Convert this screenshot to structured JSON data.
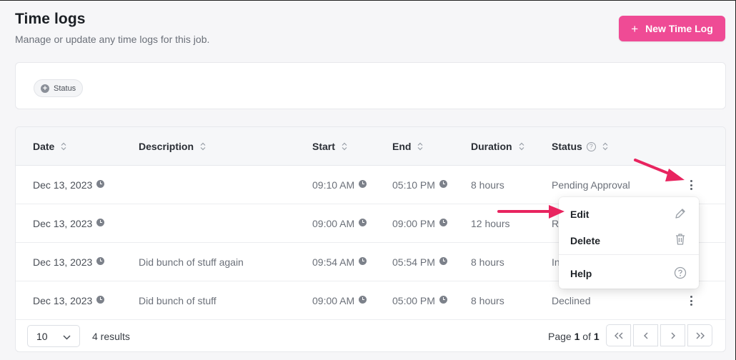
{
  "header": {
    "title": "Time logs",
    "subtitle": "Manage or update any time logs for this job.",
    "new_button_label": "New Time Log"
  },
  "filters": {
    "status_chip_label": "Status"
  },
  "table": {
    "columns": [
      "Date",
      "Description",
      "Start",
      "End",
      "Duration",
      "Status"
    ],
    "rows": [
      {
        "date": "Dec 13, 2023",
        "description": "",
        "start": "09:10 AM",
        "end": "05:10 PM",
        "duration": "8 hours",
        "status": "Pending Approval"
      },
      {
        "date": "Dec 13, 2023",
        "description": "",
        "start": "09:00 AM",
        "end": "09:00 PM",
        "duration": "12 hours",
        "status": "R"
      },
      {
        "date": "Dec 13, 2023",
        "description": "Did bunch of stuff again",
        "start": "09:54 AM",
        "end": "05:54 PM",
        "duration": "8 hours",
        "status": "In"
      },
      {
        "date": "Dec 13, 2023",
        "description": "Did bunch of stuff",
        "start": "09:00 AM",
        "end": "05:00 PM",
        "duration": "8 hours",
        "status": "Declined"
      }
    ]
  },
  "footer": {
    "page_size": "10",
    "results": "4 results",
    "page_label": "Page",
    "page_current": "1",
    "page_of": "of",
    "page_total": "1"
  },
  "context_menu": {
    "edit": "Edit",
    "delete": "Delete",
    "help": "Help"
  },
  "colors": {
    "accent": "#ef4b95",
    "annotation_arrow": "#e8245f"
  }
}
